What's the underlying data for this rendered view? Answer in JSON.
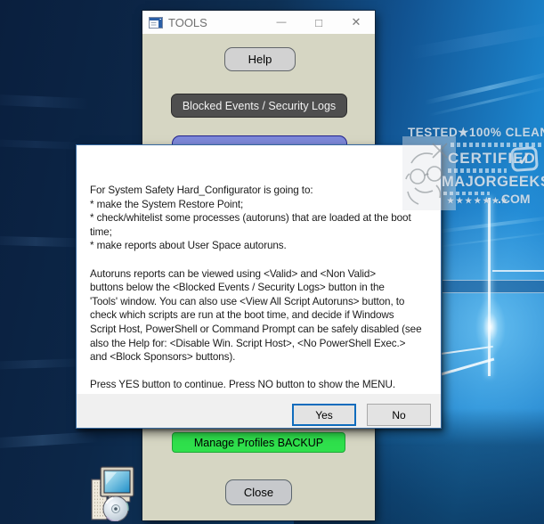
{
  "watermark": {
    "tested_line": "TESTED★100% CLEAN",
    "certified": "CERTIFIED",
    "majorgeeks": "MAJORGEEKS",
    "stars": "★★★★★★★",
    "com": ".COM",
    "check": "✓"
  },
  "tools_window": {
    "title": "TOOLS",
    "caption_buttons": {
      "minimize": "—",
      "maximize": "□",
      "close": "✕"
    },
    "buttons": {
      "help": "Help",
      "blocked_events": "Blocked Events / Security Logs",
      "manage_profiles": "Manage Profiles BACKUP",
      "close": "Close"
    }
  },
  "dialog": {
    "message_lines": [
      "For System Safety Hard_Configurator is going to:",
      "* make the System Restore Point;",
      "* check/whitelist some processes (autoruns) that are loaded at the boot",
      "time;",
      "* make reports about User Space autoruns.",
      "",
      "Autoruns reports can be viewed using <Valid> and <Non Valid>",
      "buttons below the <Blocked Events / Security Logs> button in the",
      "'Tools' window. You can also use <View All Script Autoruns> button, to",
      "check which scripts are run at the boot time, and decide if Windows",
      "Script Host, PowerShell or Command Prompt can be safely disabled (see",
      "also the Help for: <Disable Win. Script Host>, <No PowerShell Exec.>",
      "and <Block Sponsors> buttons).",
      "",
      "Press YES button to continue. Press NO button to show the MENU."
    ],
    "buttons": {
      "yes": "Yes",
      "no": "No"
    }
  },
  "colors": {
    "wallpaper_bright_blue": "#1a7fd0",
    "wallpaper_dark_navy": "#0a1f3e",
    "tools_window_body": "#d6d6c3",
    "green_button": "#2fe04c",
    "dark_button": "#4e4e4e",
    "blue_button": "#7d88d9",
    "yes_button_border": "#0f6cbd",
    "dialog_background": "#ffffff",
    "dialog_footer": "#f0f0f0"
  }
}
